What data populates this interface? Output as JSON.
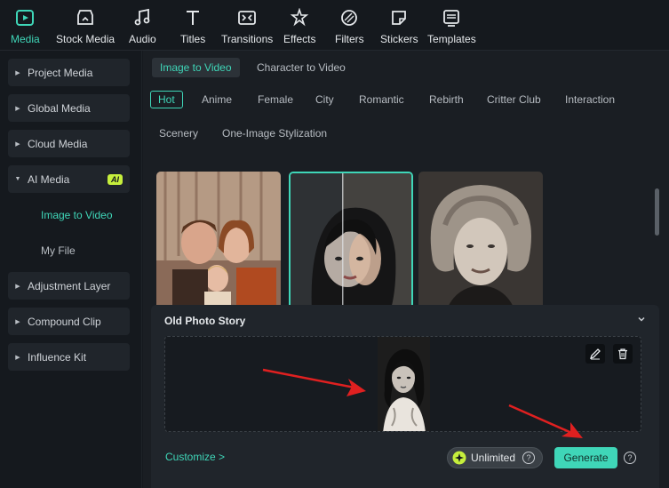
{
  "toolbar": {
    "items": [
      {
        "label": "Media",
        "icon": "media-icon",
        "active": true
      },
      {
        "label": "Stock Media",
        "icon": "stock-media-icon"
      },
      {
        "label": "Audio",
        "icon": "music-note-icon"
      },
      {
        "label": "Titles",
        "icon": "title-t-icon"
      },
      {
        "label": "Transitions",
        "icon": "transitions-icon"
      },
      {
        "label": "Effects",
        "icon": "effects-star-icon"
      },
      {
        "label": "Filters",
        "icon": "filters-icon"
      },
      {
        "label": "Stickers",
        "icon": "stickers-icon"
      },
      {
        "label": "Templates",
        "icon": "templates-icon"
      }
    ]
  },
  "sidebar": {
    "items": [
      {
        "label": "Project Media"
      },
      {
        "label": "Global Media"
      },
      {
        "label": "Cloud Media"
      },
      {
        "label": "AI Media",
        "badge": "AI",
        "expanded": true
      },
      {
        "label": "Image to Video",
        "sub": true,
        "active": true
      },
      {
        "label": "My File",
        "sub": true
      },
      {
        "label": "Adjustment Layer"
      },
      {
        "label": "Compound Clip"
      },
      {
        "label": "Influence Kit"
      }
    ]
  },
  "main": {
    "tabs": [
      "Image to Video",
      "Character to Video"
    ],
    "categories": [
      "Hot",
      "Anime",
      "Female",
      "City",
      "Romantic",
      "Rebirth",
      "Critter Club",
      "Interaction",
      "Scenery",
      "One-Image Stylization"
    ],
    "active_category": "Hot"
  },
  "panel": {
    "title": "Old Photo Story",
    "customize": "Customize >",
    "unlimited": "Unlimited",
    "generate": "Generate",
    "help": "?"
  },
  "colors": {
    "accent": "#3fd6b8",
    "ai_badge": "#c6ef3c",
    "arrow": "#e02020"
  }
}
